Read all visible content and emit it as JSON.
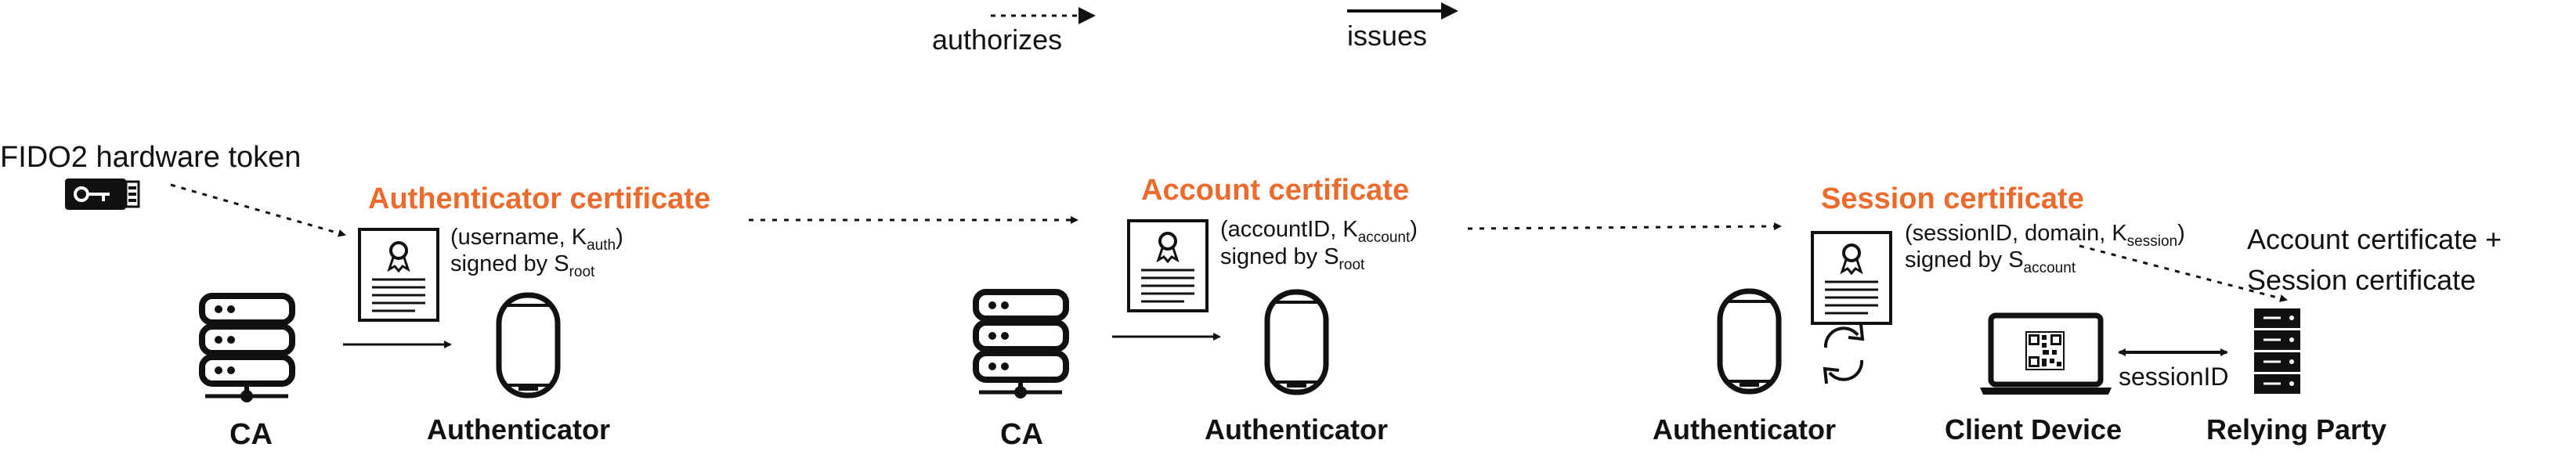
{
  "legend": {
    "authorizes": "authorizes",
    "issues": "issues"
  },
  "hardware_token": {
    "label": "FIDO2 hardware token"
  },
  "certificates": {
    "authenticator": {
      "title": "Authenticator certificate",
      "line1_pre": "(username, K",
      "line1_sub": "auth",
      "line1_post": ")",
      "line2_pre": "signed by S",
      "line2_sub": "root"
    },
    "account": {
      "title": "Account certificate",
      "line1_pre": "(accountID, K",
      "line1_sub": "account",
      "line1_post": ")",
      "line2_pre": "signed by S",
      "line2_sub": "root"
    },
    "session": {
      "title": "Session certificate",
      "line1_pre": "(sessionID, domain, K",
      "line1_sub": "session",
      "line1_post": ")",
      "line2_pre": "signed by S",
      "line2_sub": "account"
    }
  },
  "nodes": {
    "ca1": "CA",
    "authenticator1": "Authenticator",
    "ca2": "CA",
    "authenticator2": "Authenticator",
    "authenticator3": "Authenticator",
    "client_device": "Client Device",
    "relying_party": "Relying Party"
  },
  "relying_party_note": {
    "line1": "Account certificate +",
    "line2": "Session certificate"
  },
  "session_link": {
    "label": "sessionID"
  },
  "colors": {
    "accent": "#EC6A2C",
    "ink": "#111111"
  }
}
